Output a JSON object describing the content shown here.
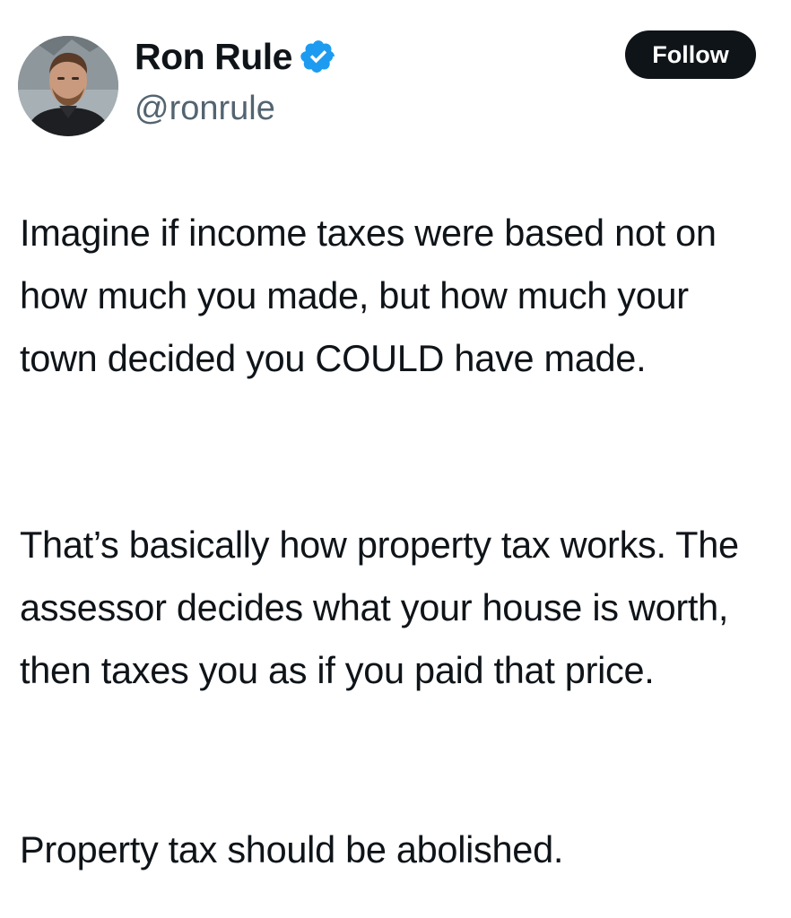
{
  "author": {
    "display_name": "Ron Rule",
    "handle": "@ronrule",
    "verified_icon": "verified-badge-icon",
    "verified_color": "#1d9bf0"
  },
  "follow_button": {
    "label": "Follow",
    "background": "#0f1419",
    "text_color": "#ffffff"
  },
  "tweet": {
    "paragraphs": [
      "Imagine if income taxes were based not on how much you made, but how much your town decided you COULD have made.",
      "That’s basically how property tax works. The assessor decides what your house is worth, then taxes you as if you paid that price.",
      "Property tax should be abolished."
    ]
  }
}
